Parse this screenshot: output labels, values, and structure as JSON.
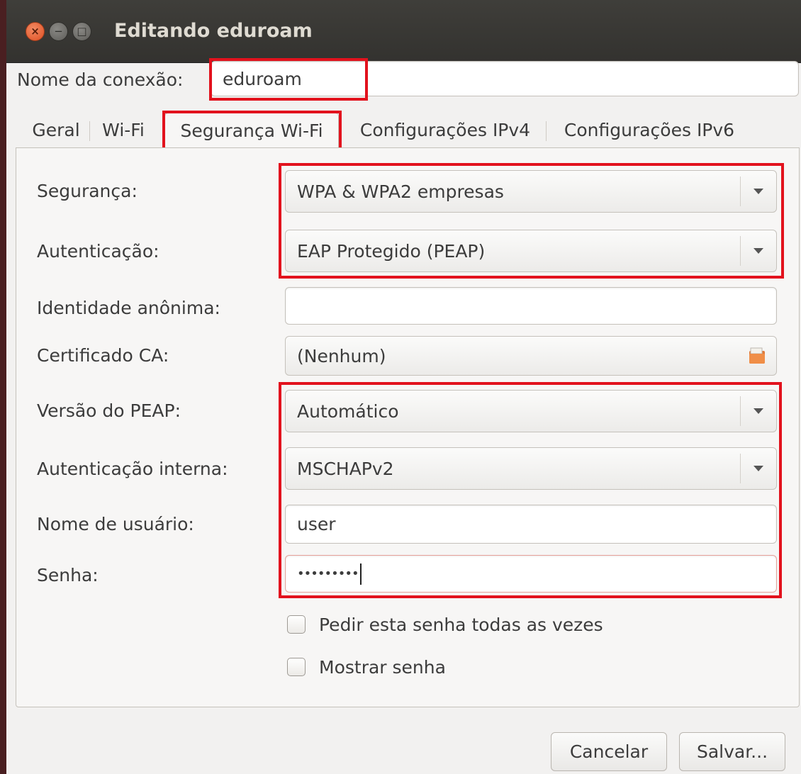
{
  "window": {
    "title": "Editando eduroam",
    "buttons": [
      "close-icon",
      "minimize-icon",
      "maximize-icon"
    ]
  },
  "connection": {
    "name_label": "Nome da conexão:",
    "name_value": "eduroam"
  },
  "tabs": [
    {
      "label": "Geral",
      "active": false
    },
    {
      "label": "Wi-Fi",
      "active": false
    },
    {
      "label": "Segurança Wi-Fi",
      "active": true
    },
    {
      "label": "Configurações IPv4",
      "active": false
    },
    {
      "label": "Configurações IPv6",
      "active": false
    }
  ],
  "form": {
    "security_label": "Segurança:",
    "security_value": "WPA & WPA2 empresas",
    "auth_label": "Autenticação:",
    "auth_value": "EAP Protegido (PEAP)",
    "anon_identity_label": "Identidade anônima:",
    "anon_identity_value": "",
    "ca_cert_label": "Certificado CA:",
    "ca_cert_value": "(Nenhum)",
    "peap_version_label": "Versão do PEAP:",
    "peap_version_value": "Automático",
    "inner_auth_label": "Autenticação interna:",
    "inner_auth_value": "MSCHAPv2",
    "username_label": "Nome de usuário:",
    "username_value": "user",
    "password_label": "Senha:",
    "password_value": "•••••••••",
    "ask_password_label": "Pedir esta senha todas as vezes",
    "ask_password_checked": false,
    "show_password_label": "Mostrar senha",
    "show_password_checked": false
  },
  "footer": {
    "cancel_label": "Cancelar",
    "save_label": "Salvar..."
  },
  "colors": {
    "highlight": "#e2121d",
    "titlebar": "#3c3b37",
    "close_button": "#e95420"
  }
}
